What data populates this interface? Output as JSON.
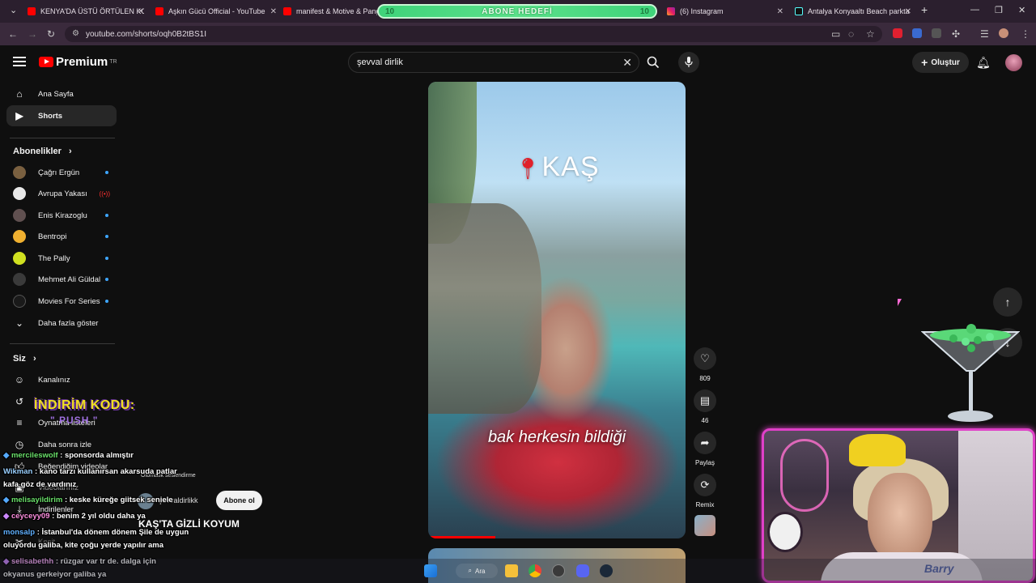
{
  "browser": {
    "tabs": [
      {
        "title": "KENYA'DA ÜSTÜ ÖRTÜLEN KON",
        "favicon": "youtube-icon"
      },
      {
        "title": "Aşkın Gücü Official - YouTube",
        "favicon": "youtube-icon"
      },
      {
        "title": "manifest & Motive & Pango",
        "favicon": "youtube-icon"
      },
      {
        "title": "(6) Instagram",
        "favicon": "instagram-icon"
      },
      {
        "title": "Antalya Konyaaltı Beach parkta",
        "favicon": "tiktok-icon"
      }
    ],
    "url": "youtube.com/shorts/oqh0B2tBS1I"
  },
  "stream_overlay": {
    "goal_left": "10",
    "goal_label": "ABONE HEDEFİ",
    "goal_right": "10",
    "promo_title": "İNDİRİM KODU:",
    "promo_code": "\" PUSH \"",
    "webcam_shirt_text": "Barry"
  },
  "youtube": {
    "brand": "Premium",
    "region": "TR",
    "search_value": "şevval dirlik",
    "create_label": "Oluştur",
    "sidebar": {
      "main": [
        {
          "label": "Ana Sayfa",
          "icon": "home-icon"
        },
        {
          "label": "Shorts",
          "icon": "shorts-icon"
        }
      ],
      "subscriptions_title": "Abonelikler",
      "subscriptions": [
        {
          "label": "Çağrı Ergün",
          "badge": "dot"
        },
        {
          "label": "Avrupa Yakası",
          "badge": "live"
        },
        {
          "label": "Enis Kirazoglu",
          "badge": "dot"
        },
        {
          "label": "Bentropi",
          "badge": "dot"
        },
        {
          "label": "The Pally",
          "badge": "dot"
        },
        {
          "label": "Mehmet Ali Güldal",
          "badge": "dot"
        },
        {
          "label": "Movies For Series",
          "badge": "dot"
        }
      ],
      "show_more": "Daha fazla göster",
      "you_title": "Siz",
      "you_items": [
        {
          "label": "Kanalınız",
          "icon": "channel-icon"
        },
        {
          "label": "Geçmiş",
          "icon": "history-icon"
        },
        {
          "label": "Oynatma listeleri",
          "icon": "playlist-icon"
        },
        {
          "label": "Daha sonra izle",
          "icon": "clock-icon"
        },
        {
          "label": "Beğendiğim videolar",
          "icon": "like-icon"
        },
        {
          "label": "Videolarınız",
          "icon": "video-icon"
        },
        {
          "label": "İndirilenler",
          "icon": "download-icon"
        },
        {
          "label": "Kesit",
          "icon": "scissors-icon"
        }
      ]
    },
    "short": {
      "overlay_place": "KAŞ",
      "caption": "bak herkesin bildiği",
      "title": "KAŞ'TA GİZLİ KOYUM",
      "channel": "şevvaldirlikk",
      "subscribe_label": "Abone ol",
      "audio_label": "Otomatik seslendirme",
      "progress": 0.26,
      "likes": "809",
      "comments": "46",
      "share_label": "Paylaş",
      "remix_label": "Remix"
    }
  },
  "chat": [
    {
      "user": "mercileswolf",
      "text": ": sponsorda almıştır"
    },
    {
      "user": "Wikman",
      "text": ": kano tarzı kullanırsan akarsuda patlar"
    },
    {
      "user": "",
      "text": "kafa göz de vardınız"
    },
    {
      "user": "melisayildirim",
      "text": ": keske küreğe giitsek seniele"
    },
    {
      "user": "ceyceyy09",
      "text": ": benim 2 yıl oldu daha ya"
    },
    {
      "user": "monsalp",
      "text": ": İstanbul'da dönem dönem Şile de uygun"
    },
    {
      "user": "",
      "text": "oluyordu galiba, kite çoğu yerde yapılır ama"
    },
    {
      "user": "selisabethh",
      "text": ": rüzgar var tr de. dalga için"
    },
    {
      "user": "",
      "text": "okyanus gerkeiyor galiba ya"
    }
  ],
  "taskbar": {
    "search_label": "Ara"
  }
}
